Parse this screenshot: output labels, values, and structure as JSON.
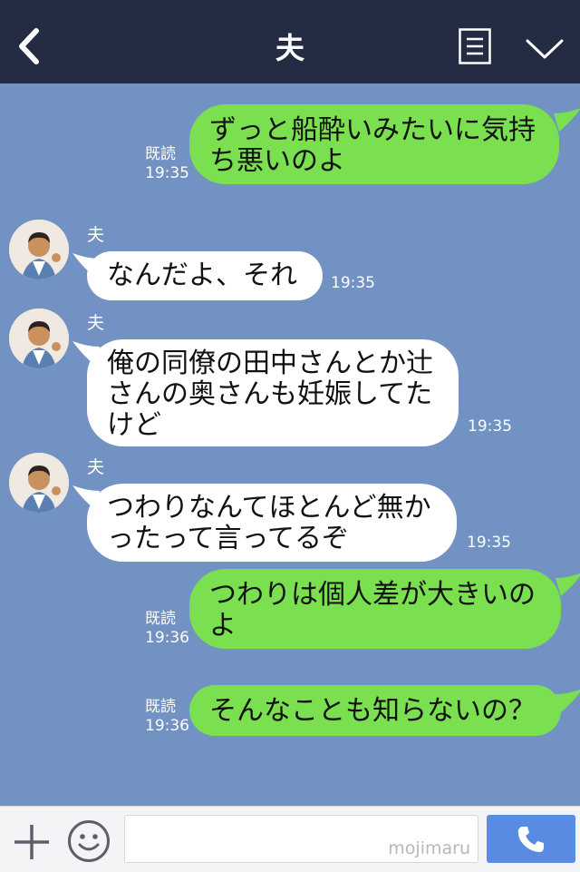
{
  "header": {
    "title": "夫"
  },
  "messages": [
    {
      "type": "out",
      "lines": [
        "ずっと船酔いみたいに気持",
        "ち悪いのよ"
      ],
      "read": "既読",
      "time": "19:35"
    },
    {
      "type": "in",
      "sender": "夫",
      "lines": [
        "なんだよ、それ"
      ],
      "time": "19:35"
    },
    {
      "type": "in",
      "sender": "夫",
      "lines": [
        "俺の同僚の田中さんとか辻",
        "さんの奥さんも妊娠してた",
        "けど"
      ],
      "time": "19:35"
    },
    {
      "type": "in",
      "sender": "夫",
      "lines": [
        "つわりなんてほとんど無か",
        "ったって言ってるぞ"
      ],
      "time": "19:35"
    },
    {
      "type": "out",
      "lines": [
        "つわりは個人差が大きいの",
        "よ"
      ],
      "read": "既読",
      "time": "19:36"
    },
    {
      "type": "out",
      "lines": [
        "そんなことも知らないの？"
      ],
      "read": "既読",
      "time": "19:36"
    }
  ],
  "footer": {
    "watermark": "mojimaru"
  },
  "colors": {
    "header": "#232c42",
    "background": "#7292c3",
    "outgoing": "#7ae04f",
    "incoming": "#ffffff",
    "call": "#5a8be2"
  },
  "icons": {
    "back": "back-icon",
    "notes": "notes-icon",
    "collapse": "chevron-down-icon",
    "plus": "plus-icon",
    "emoji": "emoji-icon",
    "call": "phone-icon"
  }
}
